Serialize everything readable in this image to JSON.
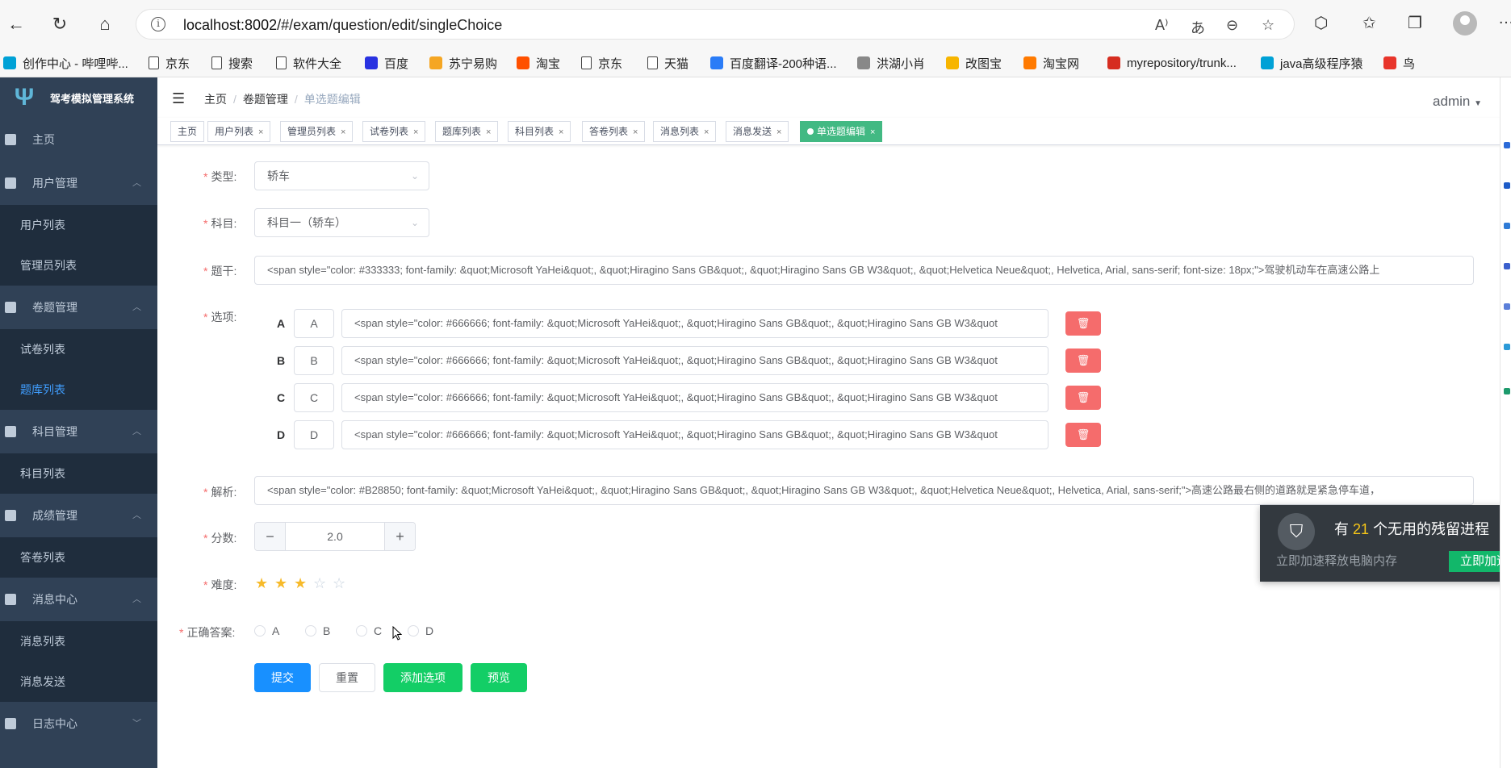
{
  "browser": {
    "url_host": "localhost:8002",
    "url_path": "/#/exam/question/edit/singleChoice"
  },
  "bookmarks": [
    {
      "label": "创作中心 - 哔哩哔...",
      "color": "#00a1d6"
    },
    {
      "label": "京东",
      "color": "doc"
    },
    {
      "label": "搜索",
      "color": "doc"
    },
    {
      "label": "软件大全",
      "color": "doc"
    },
    {
      "label": "百度",
      "color": "#2932e1"
    },
    {
      "label": "苏宁易购",
      "color": "#f5a623"
    },
    {
      "label": "淘宝",
      "color": "#ff5000"
    },
    {
      "label": "京东",
      "color": "doc"
    },
    {
      "label": "天猫",
      "color": "doc"
    },
    {
      "label": "百度翻译-200种语...",
      "color": "#2a7cf7"
    },
    {
      "label": "洪湖小肖",
      "color": "#888888"
    },
    {
      "label": "改图宝",
      "color": "#f7b500"
    },
    {
      "label": "淘宝网",
      "color": "#ff7a00"
    },
    {
      "label": "myrepository/trunk...",
      "color": "#d62d20"
    },
    {
      "label": "java高级程序猿",
      "color": "#00a1d6"
    },
    {
      "label": "鸟",
      "color": "#e8352b"
    }
  ],
  "sidebar": {
    "logo_text": "驾考模拟管理系统",
    "home": "主页",
    "groups": [
      {
        "label": "用户管理",
        "children": [
          "用户列表",
          "管理员列表"
        ]
      },
      {
        "label": "卷题管理",
        "children": [
          "试卷列表",
          "题库列表"
        ]
      },
      {
        "label": "科目管理",
        "children": [
          "科目列表"
        ]
      },
      {
        "label": "成绩管理",
        "children": [
          "答卷列表"
        ]
      },
      {
        "label": "消息中心",
        "children": [
          "消息列表",
          "消息发送"
        ]
      },
      {
        "label": "日志中心",
        "children": []
      }
    ]
  },
  "navbar": {
    "breadcrumb": [
      "主页",
      "卷题管理",
      "单选题编辑"
    ],
    "user": "admin"
  },
  "tags": [
    "主页",
    "用户列表",
    "管理员列表",
    "试卷列表",
    "题库列表",
    "科目列表",
    "答卷列表",
    "消息列表",
    "消息发送",
    "单选题编辑"
  ],
  "form": {
    "type_label": "类型:",
    "type_value": "轿车",
    "subject_label": "科目:",
    "subject_value": "科目一（轿车）",
    "title_label": "题干:",
    "title_value": "<span style=\"color: #333333; font-family: &quot;Microsoft YaHei&quot;, &quot;Hiragino Sans GB&quot;, &quot;Hiragino Sans GB W3&quot;, &quot;Helvetica Neue&quot;, Helvetica, Arial, sans-serif; font-size: 18px;\">驾驶机动车在高速公路上",
    "options_label": "选项:",
    "options": [
      {
        "letter": "A",
        "key": "A",
        "value": "<span style=\"color: #666666; font-family: &quot;Microsoft YaHei&quot;, &quot;Hiragino Sans GB&quot;, &quot;Hiragino Sans GB W3&quot"
      },
      {
        "letter": "B",
        "key": "B",
        "value": "<span style=\"color: #666666; font-family: &quot;Microsoft YaHei&quot;, &quot;Hiragino Sans GB&quot;, &quot;Hiragino Sans GB W3&quot"
      },
      {
        "letter": "C",
        "key": "C",
        "value": "<span style=\"color: #666666; font-family: &quot;Microsoft YaHei&quot;, &quot;Hiragino Sans GB&quot;, &quot;Hiragino Sans GB W3&quot"
      },
      {
        "letter": "D",
        "key": "D",
        "value": "<span style=\"color: #666666; font-family: &quot;Microsoft YaHei&quot;, &quot;Hiragino Sans GB&quot;, &quot;Hiragino Sans GB W3&quot"
      }
    ],
    "analysis_label": "解析:",
    "analysis_value": "<span style=\"color: #B28850; font-family: &quot;Microsoft YaHei&quot;, &quot;Hiragino Sans GB&quot;, &quot;Hiragino Sans GB W3&quot;, &quot;Helvetica Neue&quot;, Helvetica, Arial, sans-serif;\">高速公路最右侧的道路就是紧急停车道，",
    "score_label": "分数:",
    "score_value": "2.0",
    "score_dec": "−",
    "score_inc": "+",
    "difficulty_label": "难度:",
    "difficulty_rating": 3,
    "difficulty_max": 5,
    "answer_label": "正确答案:",
    "answers": [
      "A",
      "B",
      "C",
      "D"
    ],
    "buttons": {
      "submit": "提交",
      "reset": "重置",
      "add_option": "添加选项",
      "preview": "预览"
    }
  },
  "toast": {
    "title_prefix": "有",
    "title_count": "21",
    "title_suffix": "个无用的残留进程",
    "subtitle": "立即加速释放电脑内存",
    "action": "立即加速"
  },
  "colors": {
    "sidebar_bg": "#304156",
    "active_tag": "#42b983",
    "primary": "#1890ff",
    "success": "#13ce66",
    "danger": "#f56c6c",
    "star": "#f7ba2a"
  }
}
